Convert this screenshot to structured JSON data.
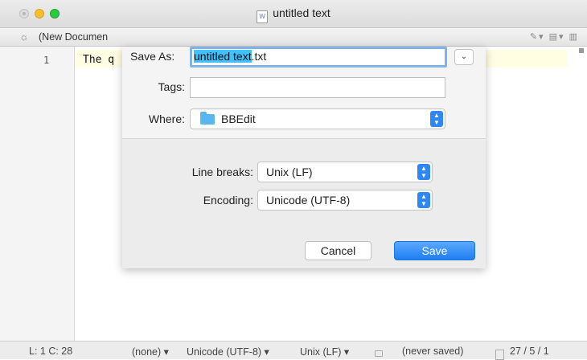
{
  "window": {
    "title": "untitled text"
  },
  "navbar": {
    "document_name": "(New Documen",
    "tools_text": "✎▾  ▤▾  ▥"
  },
  "editor": {
    "line_number": "1",
    "code_line": "The q"
  },
  "status": {
    "position": "L: 1 C: 28",
    "language": "(none) ▾",
    "encoding": "Unicode (UTF-8) ▾",
    "line_breaks": "Unix (LF) ▾",
    "saved_state": "(never saved)",
    "counts": "27 / 5 / 1"
  },
  "save_sheet": {
    "save_as_label": "Save As:",
    "filename_selected": "untitled text",
    "filename_ext": ".txt",
    "tags_label": "Tags:",
    "tags_value": "",
    "where_label": "Where:",
    "where_value": "BBEdit",
    "line_breaks_label": "Line breaks:",
    "line_breaks_value": "Unix (LF)",
    "encoding_label": "Encoding:",
    "encoding_value": "Unicode (UTF-8)",
    "cancel_label": "Cancel",
    "save_label": "Save"
  },
  "colors": {
    "accent": "#1f7ef3",
    "selection": "#42c1ff",
    "folder": "#5ab6ef",
    "line_highlight": "#fffde2"
  }
}
